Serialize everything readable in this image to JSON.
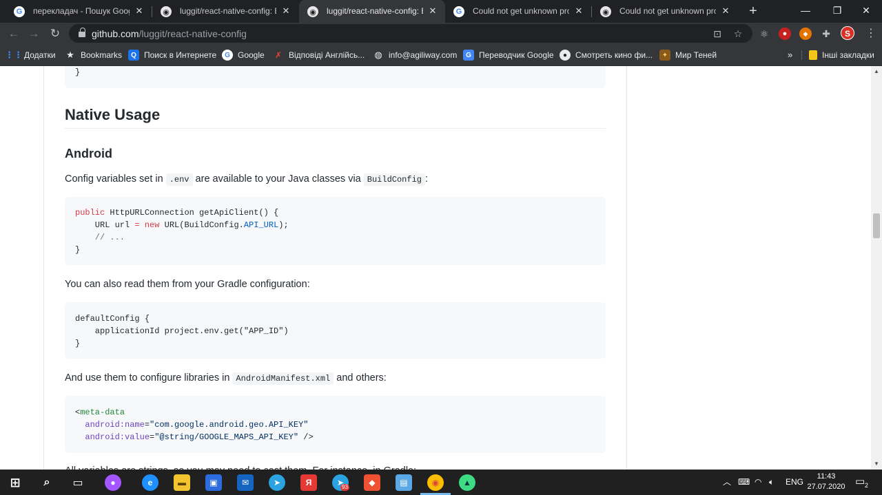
{
  "tabs": [
    {
      "title": "перекладач - Пошук Google",
      "icon": "google-icon",
      "active": false
    },
    {
      "title": "luggit/react-native-config: Brin",
      "icon": "github-icon",
      "active": false
    },
    {
      "title": "luggit/react-native-config: Brin",
      "icon": "github-icon",
      "active": true
    },
    {
      "title": "Could not get unknown prope",
      "icon": "google-icon",
      "active": false
    },
    {
      "title": "Could not get unknown prope",
      "icon": "github-icon",
      "active": false
    }
  ],
  "address": {
    "host": "github.com",
    "path": "/luggit/react-native-config"
  },
  "profile_initial": "S",
  "bookmarks": [
    {
      "label": "Додатки",
      "icon": "apps-grid-icon"
    },
    {
      "label": "Bookmarks",
      "icon": "star-icon"
    },
    {
      "label": "Поиск в Интернете",
      "icon": "search-icon"
    },
    {
      "label": "Google",
      "icon": "google-icon"
    },
    {
      "label": "Відповіді Англійсь...",
      "icon": "answers-icon"
    },
    {
      "label": "info@agiliway.com",
      "icon": "globe-icon"
    },
    {
      "label": "Переводчик Google",
      "icon": "translate-icon"
    },
    {
      "label": "Смотреть кино фи...",
      "icon": "movie-icon"
    },
    {
      "label": "Мир Теней",
      "icon": "shadow-world-icon"
    }
  ],
  "other_bookmarks": "Інші закладки",
  "page": {
    "top_code_closing": "}",
    "h2": "Native Usage",
    "h3": "Android",
    "para1": {
      "before": "Config variables set in",
      "code1": ".env",
      "middle": "are available to your Java classes via",
      "code2": "BuildConfig",
      "after": ":"
    },
    "code1": {
      "l1_kw": "public",
      "l1_rest": " HttpURLConnection getApiClient() {",
      "l2_a": "    URL url ",
      "l2_eq": "=",
      "l2_sp": " ",
      "l2_new": "new",
      "l2_b": " URL(BuildConfig.",
      "l2_const": "API_URL",
      "l2_c": ");",
      "l3": "    // ...",
      "l4": "}"
    },
    "para2": "You can also read them from your Gradle configuration:",
    "code2": {
      "l1": "defaultConfig {",
      "l2": "    applicationId project.env.get(\"APP_ID\")",
      "l3": "}"
    },
    "para3": {
      "before": "And use them to configure libraries in",
      "code": "AndroidManifest.xml",
      "after": "and others:"
    },
    "code3": {
      "l1_lt": "<",
      "l1_tag": "meta-data",
      "l2_attr": "  android:name",
      "l2_eq": "=",
      "l2_val": "\"com.google.android.geo.API_KEY\"",
      "l3_attr": "  android:value",
      "l3_eq": "=",
      "l3_val": "\"@string/GOOGLE_MAPS_API_KEY\"",
      "l3_end": " />"
    },
    "para4_partial": "All variables are strings, so you may need to cast them. For instance, in Gradle:"
  },
  "taskbar": {
    "language": "ENG",
    "time": "11:43",
    "date": "27.07.2020",
    "telegram_badge": "93",
    "notification_badge": "2"
  }
}
